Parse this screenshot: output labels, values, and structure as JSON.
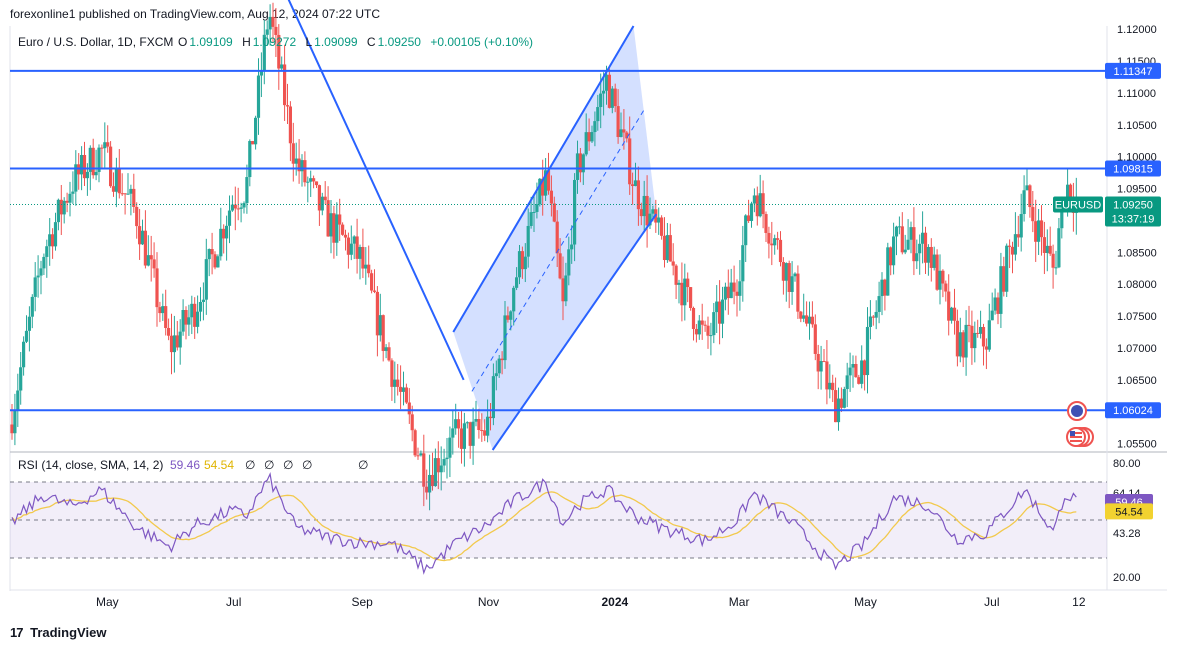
{
  "header": {
    "publisher": "forexonline1 published on TradingView.com, Aug 12, 2024 07:22 UTC",
    "symbol": "Euro / U.S. Dollar, 1D, FXCM",
    "ohlc": {
      "o_label": "O",
      "o": "1.09109",
      "h_label": "H",
      "h": "1.09272",
      "l_label": "L",
      "l": "1.09099",
      "c_label": "C",
      "c": "1.09250",
      "change": "+0.00105 (+0.10%)"
    }
  },
  "rsi_header": {
    "label": "RSI (14, close, SMA, 14, 2)",
    "rsi": "59.46",
    "sma": "54.54",
    "markers": [
      "∅",
      "∅",
      "∅",
      "∅",
      "∅"
    ]
  },
  "footer": {
    "brand": "TradingView",
    "logo": "17"
  },
  "colors": {
    "up": "#26a69a",
    "down": "#ef5350",
    "line": "#2962ff",
    "channel_fill": "#2962ff",
    "rsi_line": "#7e57c2",
    "rsi_sma": "#f2c94c",
    "rsi_band": "#7e57c2",
    "last_price_label": "#089981"
  },
  "chart_data": {
    "type": "candlestick",
    "symbol": "EURUSD",
    "timeframe": "1D",
    "x_tick_labels": [
      "May",
      "Jul",
      "Sep",
      "Nov",
      "2024",
      "Mar",
      "May",
      "Jul",
      "12"
    ],
    "y_tick_labels": [
      "1.12000",
      "1.11500",
      "1.11000",
      "1.10500",
      "1.10000",
      "1.09500",
      "1.09000",
      "1.08500",
      "1.08000",
      "1.07500",
      "1.07000",
      "1.06500",
      "1.06000",
      "1.05500"
    ],
    "ylim": [
      1.054,
      1.1205
    ],
    "last_price": {
      "value": "1.09250",
      "countdown": "13:37:19",
      "label": "EURUSD"
    },
    "horizontal_lines": [
      {
        "label": "1.11347",
        "value": 1.11347
      },
      {
        "label": "1.09815",
        "value": 1.09815
      },
      {
        "label": "1.06024",
        "value": 1.06024
      }
    ],
    "trend_line": {
      "start": [
        "2023-07-27",
        1.125
      ],
      "end": [
        "2023-10-20",
        1.065
      ]
    },
    "channel": {
      "upper": {
        "start": [
          "2023-10-15",
          1.0725
        ],
        "end": [
          "2024-01-10",
          1.1205
        ]
      },
      "lower": {
        "start": [
          "2023-11-03",
          1.054
        ],
        "end": [
          "2024-01-21",
          1.091
        ]
      },
      "mid": {
        "start": [
          "2023-10-24",
          1.0632
        ],
        "end": [
          "2024-01-15",
          1.1073
        ]
      }
    },
    "price_path": [
      [
        "2023-03-15",
        1.058
      ],
      [
        "2023-03-31",
        1.085
      ],
      [
        "2023-04-14",
        1.096
      ],
      [
        "2023-04-28",
        1.101
      ],
      [
        "2023-05-15",
        1.091
      ],
      [
        "2023-05-31",
        1.07
      ],
      [
        "2023-06-12",
        1.076
      ],
      [
        "2023-06-30",
        1.093
      ],
      [
        "2023-07-07",
        1.095
      ],
      [
        "2023-07-18",
        1.123
      ],
      [
        "2023-07-31",
        1.099
      ],
      [
        "2023-08-15",
        1.09
      ],
      [
        "2023-08-31",
        1.084
      ],
      [
        "2023-09-15",
        1.067
      ],
      [
        "2023-10-02",
        1.05
      ],
      [
        "2023-10-16",
        1.056
      ],
      [
        "2023-10-31",
        1.057
      ],
      [
        "2023-11-13",
        1.08
      ],
      [
        "2023-11-29",
        1.097
      ],
      [
        "2023-12-07",
        1.076
      ],
      [
        "2023-12-14",
        1.098
      ],
      [
        "2023-12-28",
        1.112
      ],
      [
        "2024-01-11",
        1.095
      ],
      [
        "2024-01-26",
        1.085
      ],
      [
        "2024-02-14",
        1.071
      ],
      [
        "2024-02-29",
        1.081
      ],
      [
        "2024-03-08",
        1.095
      ],
      [
        "2024-03-28",
        1.079
      ],
      [
        "2024-04-16",
        1.061
      ],
      [
        "2024-04-30",
        1.068
      ],
      [
        "2024-05-15",
        1.087
      ],
      [
        "2024-05-31",
        1.086
      ],
      [
        "2024-06-14",
        1.071
      ],
      [
        "2024-06-28",
        1.071
      ],
      [
        "2024-07-17",
        1.094
      ],
      [
        "2024-07-31",
        1.082
      ],
      [
        "2024-08-05",
        1.096
      ],
      [
        "2024-08-12",
        1.0925
      ]
    ],
    "rsi": {
      "ylim": [
        20,
        80
      ],
      "y_tick_labels": [
        "80.00",
        "64.14",
        "43.28",
        "20.00"
      ],
      "band": [
        30,
        70
      ],
      "middle": 50,
      "current": "59.46",
      "sma_current": "54.54",
      "path": [
        [
          "2023-03-15",
          48
        ],
        [
          "2023-03-31",
          63
        ],
        [
          "2023-04-14",
          57
        ],
        [
          "2023-04-28",
          66
        ],
        [
          "2023-05-15",
          46
        ],
        [
          "2023-05-31",
          36
        ],
        [
          "2023-06-12",
          47
        ],
        [
          "2023-06-30",
          55
        ],
        [
          "2023-07-07",
          52
        ],
        [
          "2023-07-18",
          72
        ],
        [
          "2023-07-31",
          46
        ],
        [
          "2023-08-15",
          41
        ],
        [
          "2023-08-31",
          38
        ],
        [
          "2023-09-15",
          38
        ],
        [
          "2023-10-02",
          24
        ],
        [
          "2023-10-16",
          38
        ],
        [
          "2023-10-31",
          47
        ],
        [
          "2023-11-13",
          60
        ],
        [
          "2023-11-29",
          70
        ],
        [
          "2023-12-07",
          48
        ],
        [
          "2023-12-14",
          58
        ],
        [
          "2023-12-28",
          66
        ],
        [
          "2024-01-11",
          52
        ],
        [
          "2024-01-26",
          45
        ],
        [
          "2024-02-14",
          39
        ],
        [
          "2024-02-29",
          50
        ],
        [
          "2024-03-08",
          64
        ],
        [
          "2024-03-28",
          47
        ],
        [
          "2024-04-16",
          25
        ],
        [
          "2024-04-30",
          37
        ],
        [
          "2024-05-15",
          62
        ],
        [
          "2024-05-31",
          58
        ],
        [
          "2024-06-14",
          40
        ],
        [
          "2024-06-28",
          43
        ],
        [
          "2024-07-17",
          66
        ],
        [
          "2024-07-31",
          43
        ],
        [
          "2024-08-05",
          64
        ],
        [
          "2024-08-12",
          59.46
        ]
      ]
    }
  }
}
